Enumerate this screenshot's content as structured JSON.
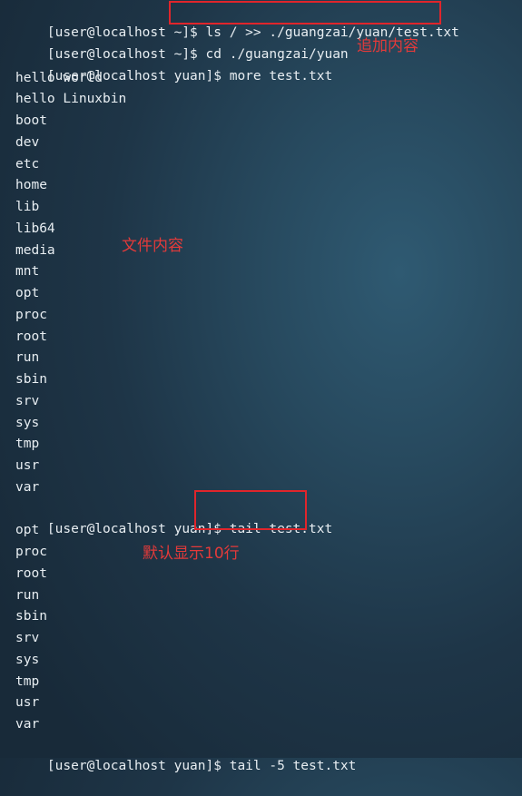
{
  "prompts": {
    "home": "[user@localhost ~]$ ",
    "yuan": "[user@localhost yuan]$ "
  },
  "commands": {
    "append": "ls / >> ./guangzai/yuan/test.txt",
    "cd": "cd ./guangzai/yuan",
    "more": "more test.txt",
    "tail": "tail test.txt",
    "tail5": "tail -5 test.txt"
  },
  "more_output": [
    "hello world",
    "hello Linuxbin",
    "boot",
    "dev",
    "etc",
    "home",
    "lib",
    "lib64",
    "media",
    "mnt",
    "opt",
    "proc",
    "root",
    "run",
    "sbin",
    "srv",
    "sys",
    "tmp",
    "usr",
    "var"
  ],
  "tail_output": [
    "opt",
    "proc",
    "root",
    "run",
    "sbin",
    "srv",
    "sys",
    "tmp",
    "usr",
    "var"
  ],
  "annotations": {
    "append": "追加内容",
    "file_content": "文件内容",
    "default_10": "默认显示10行"
  },
  "colors": {
    "text": "#e8eef2",
    "highlight": "#e0252b",
    "annotation": "#e33a3a"
  }
}
